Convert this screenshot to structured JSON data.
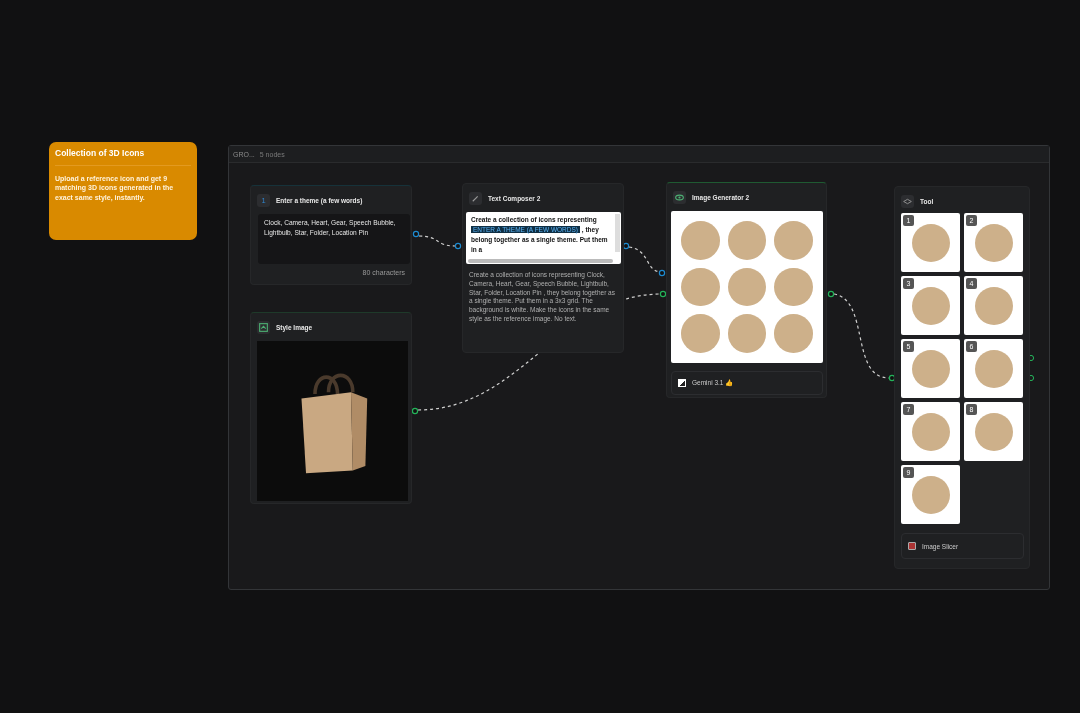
{
  "note": {
    "title": "Collection of 3D Icons",
    "description": "Upload a reference icon and get 9 matching 3D icons generated in the exact same style, instantly."
  },
  "group": {
    "title": "GRO...",
    "count": "5 nodes"
  },
  "theme_node": {
    "number": "1",
    "title": "Enter a theme (a few words)",
    "value": "Clock, Camera, Heart, Gear, Speech Bubble, Lightbulb, Star, Folder, Location Pin",
    "char_count": "80 characters"
  },
  "style_node": {
    "title": "Style Image"
  },
  "composer_node": {
    "title": "Text Composer 2",
    "text_before": "Create a collection of icons representing",
    "token": "ENTER A THEME (A FEW WORDS)",
    "text_after": ", they belong together as a single theme. Put them in a",
    "preview": "Create a collection of icons representing  Clock, Camera, Heart, Gear, Speech Bubble, Lightbulb, Star, Folder, Location Pin , they belong together as a single theme. Put them in a 3x3 grid. The background is white. Make the icons in the same style as the reference image. No text."
  },
  "generator_node": {
    "title": "Image Generator 2",
    "model": "Gemini 3.1 👍"
  },
  "tool_node": {
    "title": "Tool",
    "tiles": [
      {
        "label": "1"
      },
      {
        "label": "2"
      },
      {
        "label": "3"
      },
      {
        "label": "4"
      },
      {
        "label": "5"
      },
      {
        "label": "6"
      },
      {
        "label": "7"
      },
      {
        "label": "8"
      },
      {
        "label": "9"
      }
    ],
    "footer": "Image Slicer"
  }
}
